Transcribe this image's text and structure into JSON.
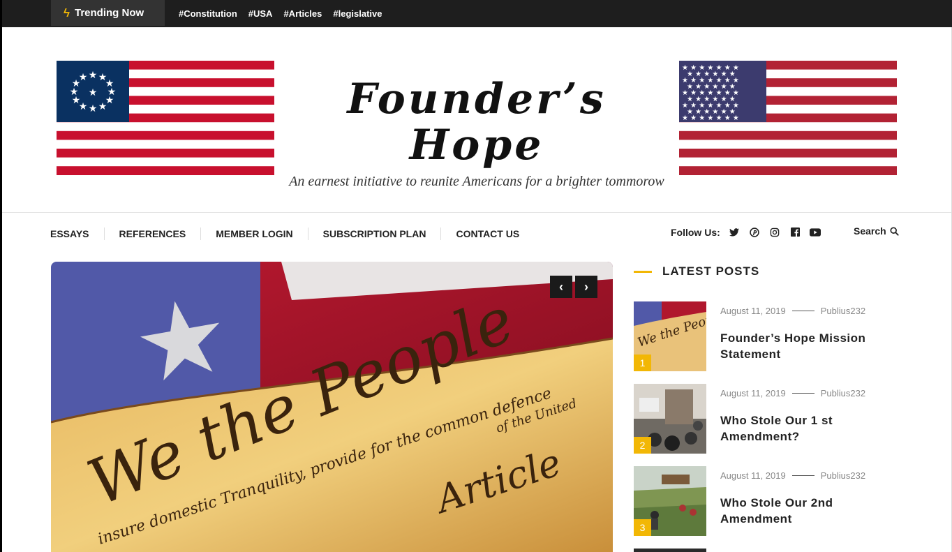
{
  "topbar": {
    "trending_label": "Trending Now",
    "tags": [
      "#Constitution",
      "#USA",
      "#Articles",
      "#legislative"
    ]
  },
  "header": {
    "title": "Founder’s Hope",
    "tagline": "An earnest initiative to reunite Americans for a brighter tommorow"
  },
  "nav": {
    "items": [
      "ESSAYS",
      "REFERENCES",
      "MEMBER LOGIN",
      "SUBSCRIPTION PLAN",
      "CONTACT US"
    ],
    "follow_label": "Follow Us:",
    "social_icons": [
      "twitter-icon",
      "pinterest-icon",
      "instagram-icon",
      "facebook-icon",
      "youtube-icon"
    ],
    "search_label": "Search"
  },
  "hero": {
    "prev_icon": "‹",
    "next_icon": "›"
  },
  "sidebar": {
    "title": "LATEST POSTS",
    "posts": [
      {
        "num": "1",
        "date": "August 11, 2019",
        "author": "Publius232",
        "title": "Founder’s Hope Mission Statement"
      },
      {
        "num": "2",
        "date": "August 11, 2019",
        "author": "Publius232",
        "title": "Who Stole Our 1 st Amendment?"
      },
      {
        "num": "3",
        "date": "August 11, 2019",
        "author": "Publius232",
        "title": "Who Stole Our 2nd Amendment"
      }
    ]
  },
  "colors": {
    "accent": "#f2b705",
    "topbar": "#1e1e1e",
    "flag_red": "#c8102e",
    "flag_blue": "#0a3161"
  }
}
